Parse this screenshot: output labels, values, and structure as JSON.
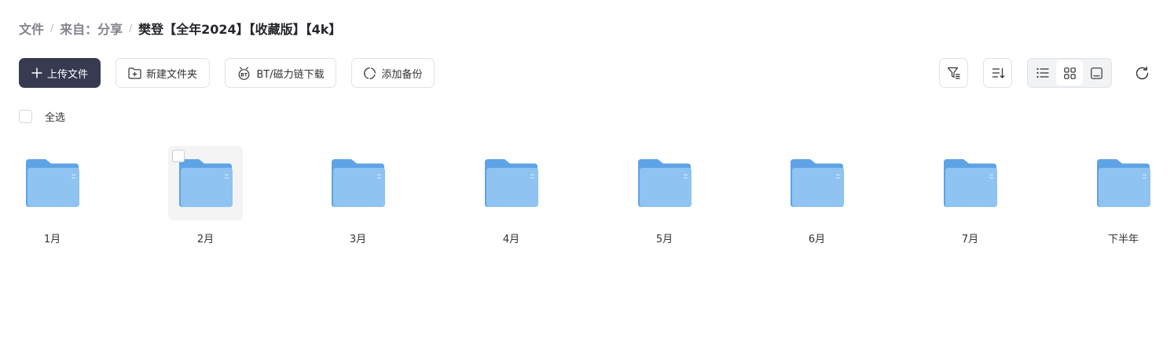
{
  "breadcrumb": {
    "items": [
      "文件",
      "来自：分享",
      "樊登【全年2024】【收藏版】【4k】"
    ],
    "separator": "/"
  },
  "toolbar": {
    "upload_label": "上传文件",
    "new_folder_label": "新建文件夹",
    "bt_download_label": "BT/磁力链下载",
    "add_backup_label": "添加备份",
    "view_mode": "grid"
  },
  "select_all_label": "全选",
  "folders": [
    {
      "name": "1月"
    },
    {
      "name": "2月"
    },
    {
      "name": "3月"
    },
    {
      "name": "4月"
    },
    {
      "name": "5月"
    },
    {
      "name": "6月"
    },
    {
      "name": "7月"
    },
    {
      "name": "下半年"
    }
  ],
  "hovered_folder": "2月",
  "colors": {
    "primary_button": "#373a50",
    "folder_blue": "#6aaeea",
    "breadcrumb_muted": "#84858d",
    "breadcrumb_current": "#25262b"
  }
}
